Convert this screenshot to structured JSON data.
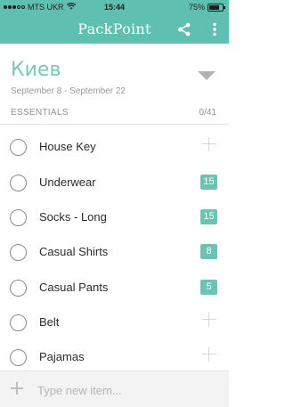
{
  "status": {
    "carrier": "MTS UKR",
    "time": "15:44",
    "battery_text": "75%",
    "battery_level": 0.75,
    "signal_icon": "signal-dots-icon",
    "wifi_icon": "wifi-icon"
  },
  "nav": {
    "title": "PackPoint",
    "share_icon": "share-icon",
    "more_icon": "more-vertical-icon",
    "color": "#5fbfb0"
  },
  "trip": {
    "name": "Киев",
    "dates": "September 8 - September 22"
  },
  "section": {
    "title": "ESSENTIALS",
    "count": "0/41"
  },
  "items": [
    {
      "label": "House Key",
      "qty": ""
    },
    {
      "label": "Underwear",
      "qty": "15"
    },
    {
      "label": "Socks - Long",
      "qty": "15"
    },
    {
      "label": "Casual Shirts",
      "qty": "8"
    },
    {
      "label": "Casual Pants",
      "qty": "5"
    },
    {
      "label": "Belt",
      "qty": ""
    },
    {
      "label": "Pajamas",
      "qty": ""
    }
  ],
  "new_item": {
    "placeholder": "Type new item..."
  },
  "colors": {
    "accent": "#5fbfb0",
    "badge": "#6cc2b3",
    "trip_name": "#7cc7bb"
  }
}
